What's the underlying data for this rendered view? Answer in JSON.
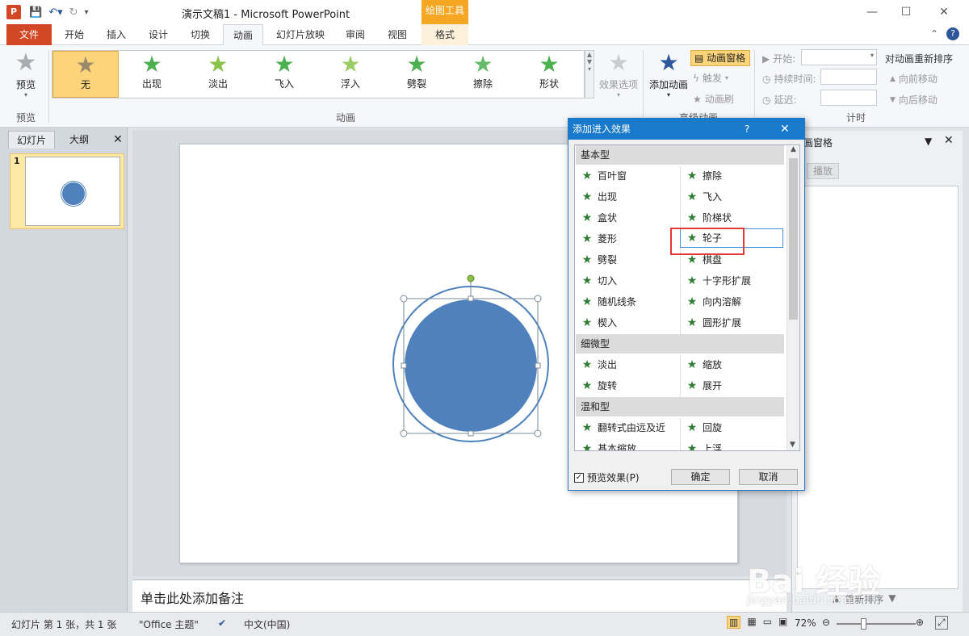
{
  "window": {
    "title": "演示文稿1 - Microsoft PowerPoint",
    "context_tab_header": "绘图工具",
    "minimize_glyph": "—",
    "maximize_glyph": "☐",
    "close_glyph": "✕"
  },
  "qat": {
    "app_icon_letter": "P"
  },
  "tabs": [
    {
      "label": "文件"
    },
    {
      "label": "开始"
    },
    {
      "label": "插入"
    },
    {
      "label": "设计"
    },
    {
      "label": "切换"
    },
    {
      "label": "动画"
    },
    {
      "label": "幻灯片放映"
    },
    {
      "label": "审阅"
    },
    {
      "label": "视图"
    },
    {
      "label": "格式"
    }
  ],
  "ribbon": {
    "preview": {
      "button_label": "预览",
      "group_label": "预览"
    },
    "animation_gallery": {
      "group_label": "动画",
      "items": [
        {
          "label": "无"
        },
        {
          "label": "出现"
        },
        {
          "label": "淡出"
        },
        {
          "label": "飞入"
        },
        {
          "label": "浮入"
        },
        {
          "label": "劈裂"
        },
        {
          "label": "擦除"
        },
        {
          "label": "形状"
        }
      ],
      "effect_options_label": "效果选项"
    },
    "advanced": {
      "add_animation_label": "添加动画",
      "animation_pane_label": "动画窗格",
      "trigger_label": "触发",
      "animation_painter_label": "动画刷",
      "group_label": "高级动画"
    },
    "timing": {
      "start_label": "开始:",
      "duration_label": "持续时间:",
      "delay_label": "延迟:",
      "reorder_label": "对动画重新排序",
      "move_earlier_label": "向前移动",
      "move_later_label": "向后移动",
      "group_label": "计时"
    }
  },
  "left_pane": {
    "tab_slides": "幻灯片",
    "tab_outline": "大纲",
    "close_glyph": "✕",
    "slide_number": "1"
  },
  "notes_placeholder": "单击此处添加备注",
  "right_pane": {
    "title": "画窗格",
    "play_label": "播放",
    "reorder_label": "重新排序"
  },
  "dialog": {
    "title": "添加进入效果",
    "help_glyph": "?",
    "close_glyph": "✕",
    "categories": [
      {
        "name": "基本型"
      },
      {
        "name": "细微型"
      },
      {
        "name": "温和型"
      }
    ],
    "basic_left": [
      "百叶窗",
      "出现",
      "盒状",
      "菱形",
      "劈裂",
      "切入",
      "随机线条",
      "楔入"
    ],
    "basic_right": [
      "擦除",
      "飞入",
      "阶梯状",
      "轮子",
      "棋盘",
      "十字形扩展",
      "向内溶解",
      "圆形扩展"
    ],
    "subtle_left": [
      "淡出",
      "旋转"
    ],
    "subtle_right": [
      "缩放",
      "展开"
    ],
    "moderate_left": [
      "翻转式由远及近",
      "基本缩放"
    ],
    "moderate_right": [
      "回旋",
      "上浮"
    ],
    "selected_effect": "轮子",
    "preview_checkbox_label": "预览效果(P)",
    "preview_checked": true,
    "ok_label": "确定",
    "cancel_label": "取消"
  },
  "statusbar": {
    "slide_info": "幻灯片 第 1 张，共 1 张",
    "theme": "\"Office 主题\"",
    "language": "中文(中国)",
    "zoom": "72%"
  },
  "watermark": {
    "text": "Bai 经验",
    "url": "jingyan.baidu.com"
  },
  "colors": {
    "accent_blue": "#1979ca",
    "file_tab": "#d24726",
    "context_orange": "#f5a623",
    "shape_fill": "#4f81bd",
    "highlight_red": "#e53935"
  }
}
